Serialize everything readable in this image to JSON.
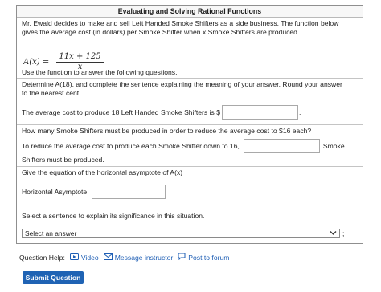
{
  "panel_title": "Evaluating and Solving Rational Functions",
  "intro": {
    "line1": "Mr. Ewald decides to make and sell Left Handed Smoke Shifters as a side business. The function below",
    "line2": "gives the average cost (in dollars) per Smoke Shifter when x Smoke Shifters are produced.",
    "formula_lhs": "A(x) =",
    "formula_num": "11x + 125",
    "formula_den": "x",
    "instruction": "Use the function to answer the following questions."
  },
  "part_a": {
    "prompt_line1": "Determine A(18), and complete the sentence explaining the meaning of your answer. Round your answer",
    "prompt_line2": "to the nearest cent.",
    "sentence_before": "The average cost to produce 18 Left Handed Smoke Shifters is $",
    "sentence_after": ".",
    "answer_value": ""
  },
  "part_b": {
    "question": "How many Smoke Shifters must be produced in order to reduce the average cost to $16 each?",
    "sentence_before": "To reduce the average cost to produce each Smoke Shifter down to 16,",
    "sentence_after": "Smoke",
    "sentence_line2": "Shifters must be produced.",
    "answer_value": ""
  },
  "part_c": {
    "prompt": "Give the equation of the horizontal asymptote of A(x)",
    "asymptote_label": "Horizontal Asymptote:",
    "asymptote_value": "",
    "select_prompt": "Select a sentence to explain its significance in this situation.",
    "select_value": "Select an answer",
    "select_trail": ";"
  },
  "help": {
    "label": "Question Help:",
    "video": "Video",
    "message": "Message instructor",
    "post": "Post to forum"
  },
  "submit_label": "Submit Question"
}
